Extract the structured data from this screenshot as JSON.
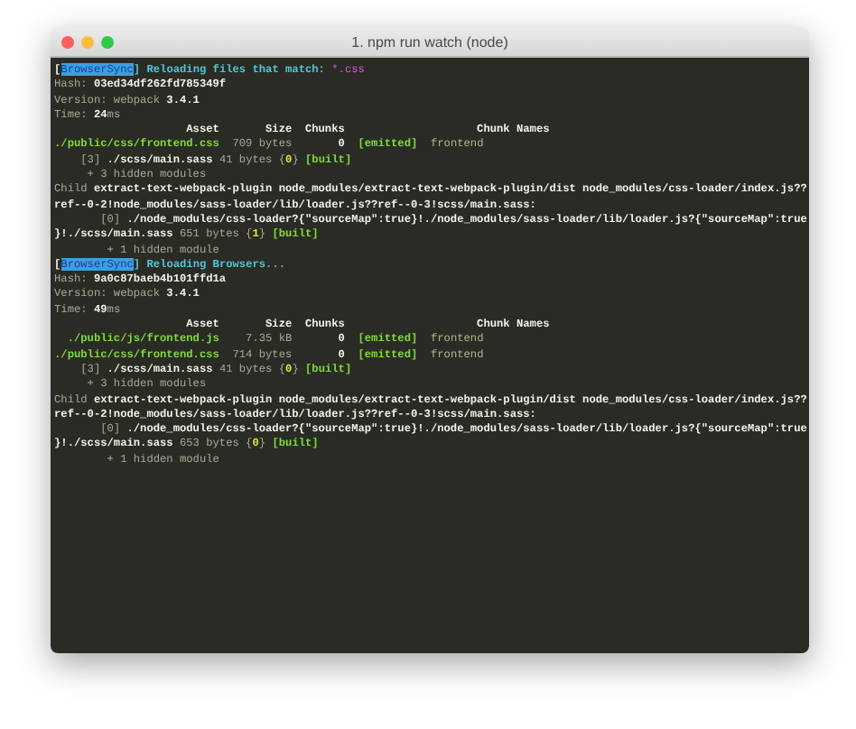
{
  "window": {
    "title": "1. npm run watch (node)"
  },
  "terminal": {
    "lines": [
      {
        "segments": [
          {
            "text": "[",
            "kind": "value"
          },
          {
            "text": "BrowserSync",
            "kind": "source"
          },
          {
            "text": "] Reloading files that match: ",
            "kind": "message"
          },
          {
            "text": "*.css",
            "kind": "pattern"
          }
        ]
      },
      {
        "segments": [
          {
            "text": "Hash: ",
            "kind": "label"
          },
          {
            "text": "03ed34df262fd785349f",
            "kind": "value"
          }
        ]
      },
      {
        "segments": [
          {
            "text": "Version: webpack ",
            "kind": "label"
          },
          {
            "text": "3.4.1",
            "kind": "value"
          }
        ]
      },
      {
        "segments": [
          {
            "text": "Time: ",
            "kind": "label"
          },
          {
            "text": "24",
            "kind": "value"
          },
          {
            "text": "ms",
            "kind": "label"
          }
        ]
      },
      {
        "segments": [
          {
            "text": "                    Asset       Size  Chunks                    Chunk Names",
            "kind": "value"
          }
        ]
      },
      {
        "segments": [
          {
            "text": "./public/css/frontend.css",
            "kind": "asset"
          },
          {
            "text": "  709 bytes       ",
            "kind": "label"
          },
          {
            "text": "0",
            "kind": "value"
          },
          {
            "text": "  [emitted]",
            "kind": "status"
          },
          {
            "text": "  frontend",
            "kind": "chunkname"
          }
        ]
      },
      {
        "segments": [
          {
            "text": "    [3] ",
            "kind": "label"
          },
          {
            "text": "./scss/main.sass",
            "kind": "value"
          },
          {
            "text": " 41 bytes {",
            "kind": "label"
          },
          {
            "text": "0",
            "kind": "chunkid"
          },
          {
            "text": "} ",
            "kind": "label"
          },
          {
            "text": "[built]",
            "kind": "status"
          }
        ]
      },
      {
        "segments": [
          {
            "text": "     + 3 hidden modules",
            "kind": "label"
          }
        ]
      },
      {
        "segments": [
          {
            "text": "Child ",
            "kind": "label"
          },
          {
            "text": "extract-text-webpack-plugin node_modules/extract-text-webpack-plugin/dist node_modules/css-loader/index.js??",
            "kind": "value"
          }
        ]
      },
      {
        "segments": [
          {
            "text": "ref--0-2!node_modules/sass-loader/lib/loader.js??ref--0-3!scss/main.sass:",
            "kind": "value"
          }
        ]
      },
      {
        "segments": [
          {
            "text": "       [0] ",
            "kind": "label"
          },
          {
            "text": "./node_modules/css-loader?{\"sourceMap\":true}!./node_modules/sass-loader/lib/loader.js?{\"sourceMap\":true",
            "kind": "value"
          }
        ]
      },
      {
        "segments": [
          {
            "text": "}!./scss/main.sass",
            "kind": "value"
          },
          {
            "text": " 651 bytes {",
            "kind": "label"
          },
          {
            "text": "1",
            "kind": "chunkid"
          },
          {
            "text": "} ",
            "kind": "label"
          },
          {
            "text": "[built]",
            "kind": "status"
          }
        ]
      },
      {
        "segments": [
          {
            "text": "        + 1 hidden module",
            "kind": "label"
          }
        ]
      },
      {
        "segments": [
          {
            "text": "[",
            "kind": "value"
          },
          {
            "text": "BrowserSync",
            "kind": "source"
          },
          {
            "text": "] Reloading Browsers...",
            "kind": "message"
          }
        ]
      },
      {
        "segments": [
          {
            "text": "Hash: ",
            "kind": "label"
          },
          {
            "text": "9a0c87baeb4b101ffd1a",
            "kind": "value"
          }
        ]
      },
      {
        "segments": [
          {
            "text": "Version: webpack ",
            "kind": "label"
          },
          {
            "text": "3.4.1",
            "kind": "value"
          }
        ]
      },
      {
        "segments": [
          {
            "text": "Time: ",
            "kind": "label"
          },
          {
            "text": "49",
            "kind": "value"
          },
          {
            "text": "ms",
            "kind": "label"
          }
        ]
      },
      {
        "segments": [
          {
            "text": "                    Asset       Size  Chunks                    Chunk Names",
            "kind": "value"
          }
        ]
      },
      {
        "segments": [
          {
            "text": "  ./public/js/frontend.js",
            "kind": "asset"
          },
          {
            "text": "    7.35 kB       ",
            "kind": "label"
          },
          {
            "text": "0",
            "kind": "value"
          },
          {
            "text": "  [emitted]",
            "kind": "status"
          },
          {
            "text": "  frontend",
            "kind": "chunkname"
          }
        ]
      },
      {
        "segments": [
          {
            "text": "./public/css/frontend.css",
            "kind": "asset"
          },
          {
            "text": "  714 bytes       ",
            "kind": "label"
          },
          {
            "text": "0",
            "kind": "value"
          },
          {
            "text": "  [emitted]",
            "kind": "status"
          },
          {
            "text": "  frontend",
            "kind": "chunkname"
          }
        ]
      },
      {
        "segments": [
          {
            "text": "    [3] ",
            "kind": "label"
          },
          {
            "text": "./scss/main.sass",
            "kind": "value"
          },
          {
            "text": " 41 bytes {",
            "kind": "label"
          },
          {
            "text": "0",
            "kind": "chunkid"
          },
          {
            "text": "} ",
            "kind": "label"
          },
          {
            "text": "[built]",
            "kind": "status"
          }
        ]
      },
      {
        "segments": [
          {
            "text": "     + 3 hidden modules",
            "kind": "label"
          }
        ]
      },
      {
        "segments": [
          {
            "text": "Child ",
            "kind": "label"
          },
          {
            "text": "extract-text-webpack-plugin node_modules/extract-text-webpack-plugin/dist node_modules/css-loader/index.js??",
            "kind": "value"
          }
        ]
      },
      {
        "segments": [
          {
            "text": "ref--0-2!node_modules/sass-loader/lib/loader.js??ref--0-3!scss/main.sass:",
            "kind": "value"
          }
        ]
      },
      {
        "segments": [
          {
            "text": "       [0] ",
            "kind": "label"
          },
          {
            "text": "./node_modules/css-loader?{\"sourceMap\":true}!./node_modules/sass-loader/lib/loader.js?{\"sourceMap\":true",
            "kind": "value"
          }
        ]
      },
      {
        "segments": [
          {
            "text": "}!./scss/main.sass",
            "kind": "value"
          },
          {
            "text": " 653 bytes {",
            "kind": "label"
          },
          {
            "text": "0",
            "kind": "chunkid"
          },
          {
            "text": "} ",
            "kind": "label"
          },
          {
            "text": "[built]",
            "kind": "status"
          }
        ]
      },
      {
        "segments": [
          {
            "text": "        + 1 hidden module",
            "kind": "label"
          }
        ]
      }
    ]
  }
}
